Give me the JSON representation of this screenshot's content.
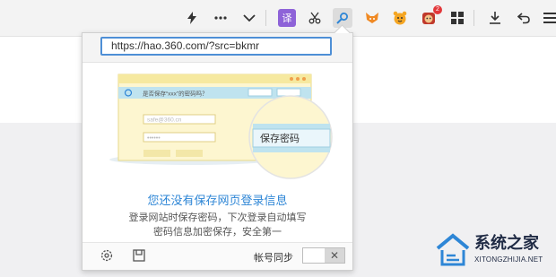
{
  "toolbar": {
    "icons": [
      "bolt-icon",
      "more-icon",
      "chevron-down-icon",
      "translate-icon",
      "scissors-icon",
      "password-key-icon",
      "extension-fox-icon",
      "extension-tiger-icon",
      "extension-monkey-icon",
      "apps-grid-icon",
      "download-icon",
      "undo-icon",
      "menu-icon"
    ],
    "translate_glyph": "译",
    "badge": "2"
  },
  "popup": {
    "url": "https://hao.360.com/?src=bkmr",
    "illustration": {
      "prompt": "是否保存“xxx”的密码吗？",
      "email": "safe@360.cn",
      "password": "••••••",
      "button": "保存密码"
    },
    "title": "您还没有保存网页登录信息",
    "description_line1": "登录网站时保存密码，下次登录自动填写",
    "description_line2": "密码信息加密保存，安全第一",
    "footer": {
      "sync_label": "帐号同步",
      "toggle_state": "off",
      "toggle_glyph": "✕"
    }
  },
  "watermark": {
    "title": "系统之家",
    "subtitle": "XITONGZHIJIA.NET"
  },
  "colors": {
    "accent": "#2e86d6",
    "url_border": "#4e8fd6",
    "illus_yellow": "#fdf6d0",
    "illus_blue": "#bfe3ef"
  }
}
